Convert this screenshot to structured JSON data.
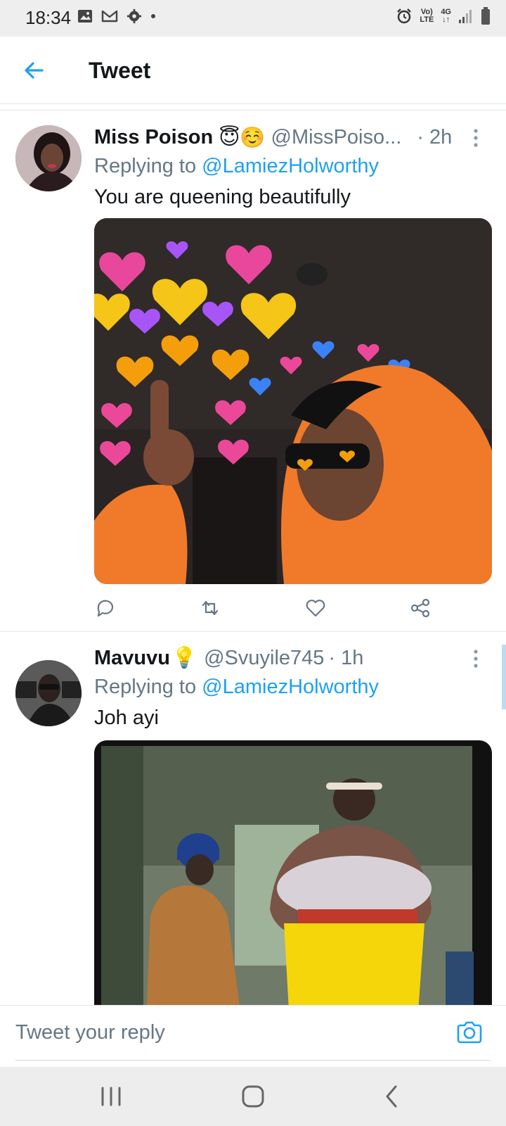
{
  "status_bar": {
    "time": "18:34",
    "lte_top": "Vo)",
    "lte_bottom": "LTE",
    "net_top": "4G",
    "net_bottom": "↓↑"
  },
  "header": {
    "title": "Tweet"
  },
  "tweets": [
    {
      "name": "Miss Poison",
      "emoji": "😇☺️",
      "handle": "@MissPoiso...",
      "time": "· 2h",
      "replying_prefix": "Replying to ",
      "replying_to": "@LamiezHolworthy",
      "text": "You are queening beautifully",
      "avatar_color": "#8b6a70"
    },
    {
      "name": "Mavuvu",
      "emoji": "💡",
      "handle": "@Svuyile745",
      "time": "· 1h",
      "replying_prefix": "Replying to ",
      "replying_to": "@LamiezHolworthy",
      "text": "Joh ayi",
      "avatar_color": "#4a4a4a"
    }
  ],
  "reply_bar": {
    "placeholder": "Tweet your reply"
  },
  "colors": {
    "accent": "#1da1f2",
    "text_secondary": "#657786",
    "divider": "#e1e8ed"
  },
  "icons": {
    "back": "arrow-left-icon",
    "more": "more-vertical-icon",
    "reply": "comment-icon",
    "retweet": "retweet-icon",
    "like": "heart-icon",
    "share": "share-icon",
    "camera": "camera-icon"
  }
}
